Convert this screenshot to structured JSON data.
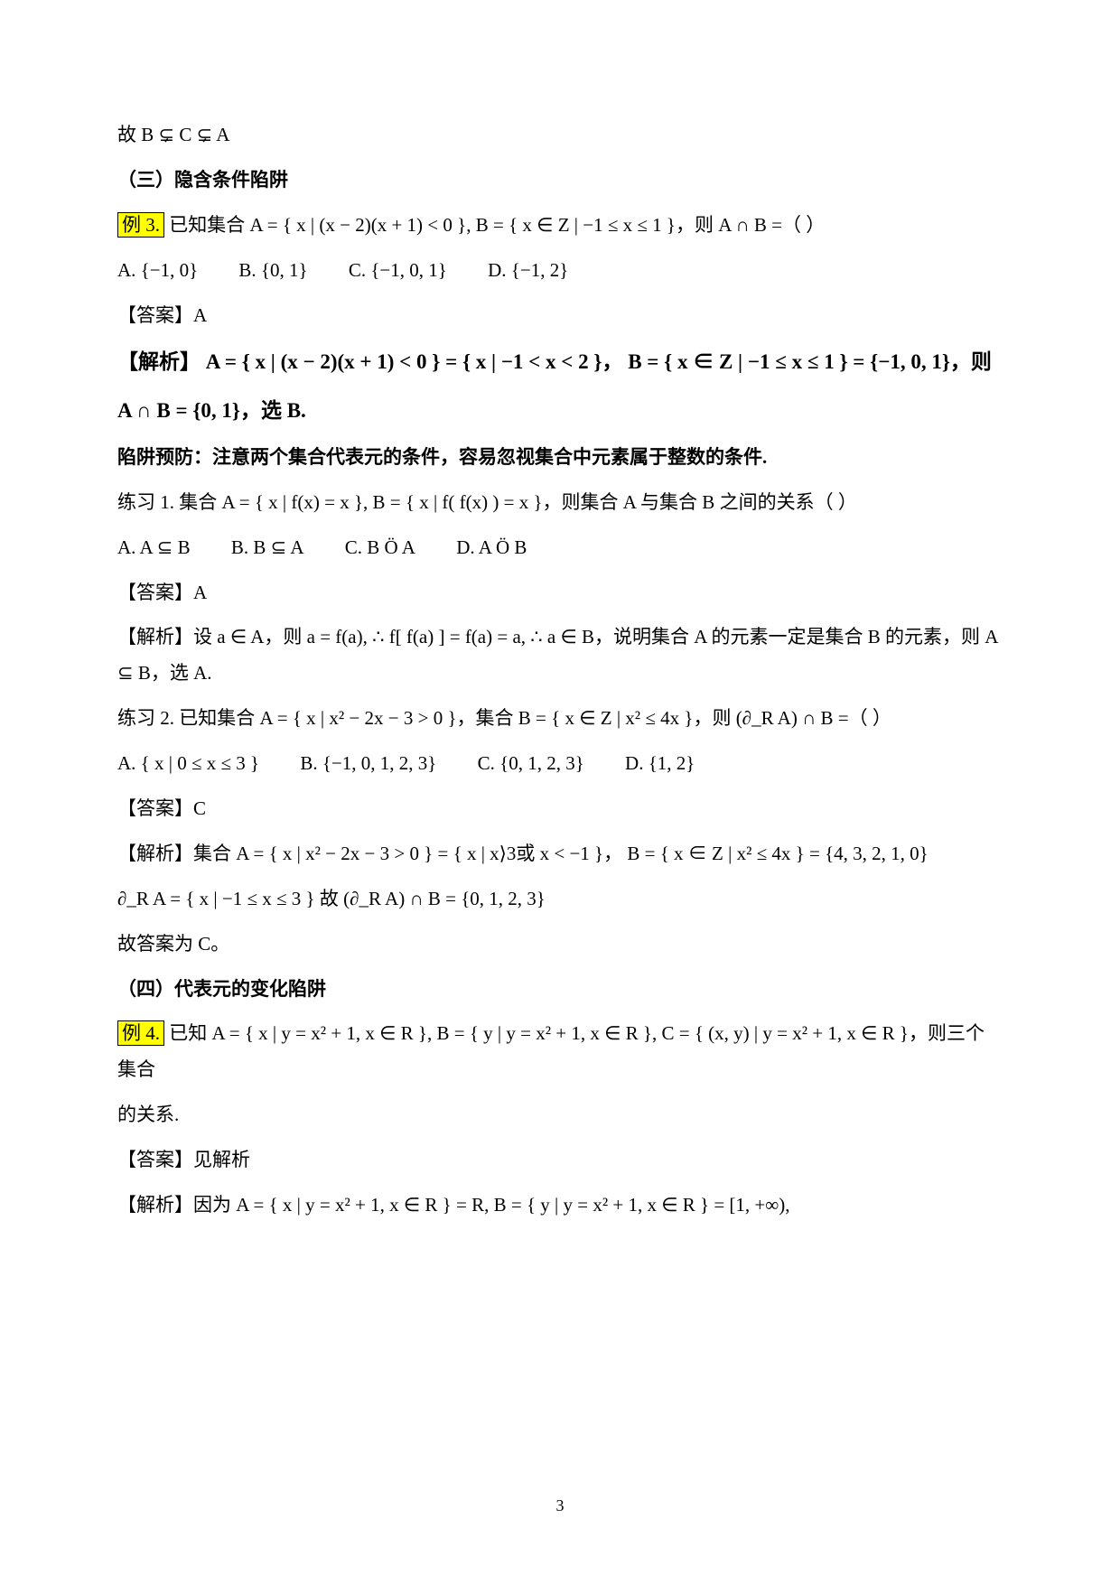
{
  "line1": "故 B ⊊ C ⊊ A",
  "sec3_title": "（三）隐含条件陷阱",
  "ex3_label": "例 3.",
  "ex3_stem": "已知集合 A = { x | (x − 2)(x + 1) < 0 }, B = { x ∈ Z | −1 ≤ x ≤ 1 }，则 A ∩ B =（    ）",
  "ex3_A": "A. {−1, 0}",
  "ex3_B": "B. {0, 1}",
  "ex3_C": "C. {−1, 0, 1}",
  "ex3_D": "D. {−1, 2}",
  "ex3_ans": "【答案】A",
  "ex3_sol_label": "【解析】",
  "ex3_sol_body1": "A = { x | (x − 2)(x + 1) < 0 } = { x | −1 < x < 2 }，  B = { x ∈ Z | −1 ≤ x ≤ 1 } = {−1, 0, 1}，则",
  "ex3_sol_body2": "A ∩ B = {0, 1}，选 B.",
  "trap_note": "陷阱预防：注意两个集合代表元的条件，容易忽视集合中元素属于整数的条件.",
  "pr1_stem": "练习 1.  集合 A = { x | f(x) = x }, B = { x | f( f(x) ) = x }，则集合 A 与集合 B 之间的关系（    ）",
  "pr1_A": "A.  A ⊆ B",
  "pr1_B": "B.  B ⊆ A",
  "pr1_C": "C.  B Ö A",
  "pr1_D": "D.  A Ö B",
  "pr1_ans": "【答案】A",
  "pr1_sol": "【解析】设 a ∈ A，则 a = f(a), ∴ f[ f(a) ] = f(a) = a, ∴ a ∈ B，说明集合 A 的元素一定是集合 B 的元素，则 A ⊆ B，选 A.",
  "pr2_stem": "练习 2.  已知集合 A = { x | x² − 2x − 3 > 0 }，集合 B = { x ∈ Z | x² ≤ 4x }，则 (∂_R A) ∩ B =（    ）",
  "pr2_A": "A. { x | 0 ≤ x ≤ 3 }",
  "pr2_B": "B. {−1, 0, 1, 2, 3}",
  "pr2_C": "C. {0, 1, 2, 3}",
  "pr2_D": "D. {1, 2}",
  "pr2_ans": "【答案】C",
  "pr2_sol1": "【解析】集合 A = { x | x² − 2x − 3 > 0 }  = { x | x⟩3或 x < −1 }，   B = { x ∈ Z | x² ≤ 4x } = {4, 3, 2, 1, 0}",
  "pr2_sol2": "∂_R A = { x | −1 ≤ x ≤ 3 }  故 (∂_R A) ∩ B = {0, 1, 2, 3}",
  "pr2_final": "故答案为 C。",
  "sec4_title": "（四）代表元的变化陷阱",
  "ex4_label": "例 4.",
  "ex4_stem1": "已知 A = { x | y = x² + 1, x ∈ R }, B = { y | y = x² + 1, x ∈ R }, C = { (x, y) | y = x² + 1, x ∈ R }，则三个集合",
  "ex4_stem2": "的关系.",
  "ex4_ans": "【答案】见解析",
  "ex4_sol": "【解析】因为 A = { x | y = x² + 1, x ∈ R } = R, B = { y | y = x² + 1, x ∈ R } = [1, +∞),",
  "page": "3"
}
